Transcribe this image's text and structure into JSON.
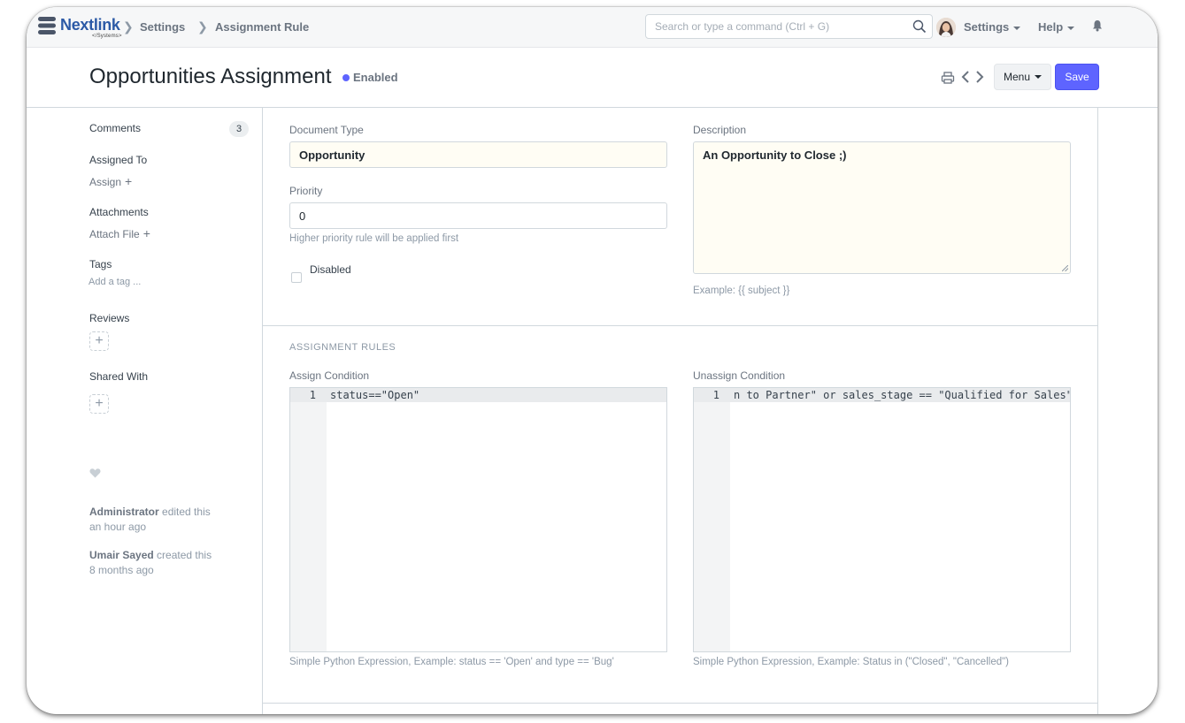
{
  "navbar": {
    "logo_text": "Nextlink",
    "logo_sub": "</Systems>",
    "breadcrumbs": [
      "Settings",
      "Assignment Rule"
    ],
    "search_placeholder": "Search or type a command (Ctrl + G)",
    "settings_label": "Settings",
    "help_label": "Help"
  },
  "page": {
    "title": "Opportunities Assignment",
    "status": "Enabled",
    "menu_label": "Menu",
    "save_label": "Save"
  },
  "sidebar": {
    "comments_label": "Comments",
    "comments_count": "3",
    "assigned_to_label": "Assigned To",
    "assign_link": "Assign",
    "attachments_label": "Attachments",
    "attach_link": "Attach File",
    "tags_label": "Tags",
    "add_tag": "Add a tag ...",
    "reviews_label": "Reviews",
    "shared_with_label": "Shared With",
    "activity": [
      {
        "user": "Administrator",
        "action": "edited this",
        "time": "an hour ago"
      },
      {
        "user": "Umair Sayed",
        "action": "created this",
        "time": "8 months ago"
      }
    ]
  },
  "form": {
    "document_type_label": "Document Type",
    "document_type_value": "Opportunity",
    "priority_label": "Priority",
    "priority_value": "0",
    "priority_help": "Higher priority rule will be applied first",
    "disabled_label": "Disabled",
    "description_label": "Description",
    "description_value": "An Opportunity to Close ;)",
    "description_help": "Example: {{ subject }}",
    "section_title": "ASSIGNMENT RULES",
    "assign_condition_label": "Assign Condition",
    "assign_condition_code": "status==\"Open\"",
    "assign_condition_line": "1",
    "assign_condition_help": "Simple Python Expression, Example: status == 'Open' and type == 'Bug'",
    "unassign_condition_label": "Unassign Condition",
    "unassign_condition_code": "n to Partner\" or sales_stage == \"Qualified for Sales\"",
    "unassign_condition_line": "1",
    "unassign_condition_help": "Simple Python Expression, Example: Status in (\"Closed\", \"Cancelled\")"
  },
  "colors": {
    "primary": "#5e64ff",
    "brand": "#2c5aa6",
    "field_highlight": "#fffdf4"
  }
}
